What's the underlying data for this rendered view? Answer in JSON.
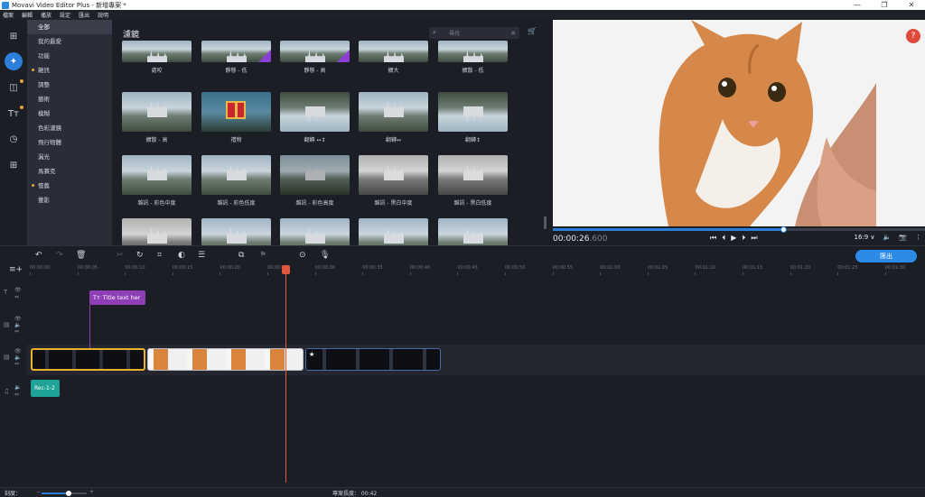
{
  "window": {
    "title": "Movavi Video Editor Plus - 新增專案 *",
    "controls": [
      "—",
      "❐",
      "✕"
    ]
  },
  "menu": [
    "檔案",
    "編輯",
    "播放",
    "設定",
    "匯出",
    "說明"
  ],
  "sidebar_tools": [
    {
      "name": "import-icon",
      "glyph": "⊞"
    },
    {
      "name": "magic-wand-icon",
      "glyph": "✦"
    },
    {
      "name": "transitions-icon",
      "glyph": "◫"
    },
    {
      "name": "titles-icon",
      "glyph": "Tт"
    },
    {
      "name": "stickers-icon",
      "glyph": "◷"
    },
    {
      "name": "more-tools-icon",
      "glyph": "⊞"
    }
  ],
  "categories": [
    {
      "label": "全部",
      "selected": true,
      "dot": false
    },
    {
      "label": "我的最愛",
      "dot": false
    },
    {
      "label": "功能",
      "dot": false
    },
    {
      "label": "雜訊",
      "dot": true
    },
    {
      "label": "調整",
      "dot": false
    },
    {
      "label": "藝術",
      "dot": false
    },
    {
      "label": "模糊",
      "dot": false
    },
    {
      "label": "色彩濾鏡",
      "dot": false
    },
    {
      "label": "飛行物體",
      "dot": false
    },
    {
      "label": "漏光",
      "dot": false
    },
    {
      "label": "馬賽克",
      "dot": false
    },
    {
      "label": "懷舊",
      "dot": true
    },
    {
      "label": "暈影",
      "dot": false
    }
  ],
  "filter_panel": {
    "title": "濾鏡",
    "search_placeholder": "尋找",
    "tiles": [
      {
        "label": "處咬",
        "style": "",
        "premium": false
      },
      {
        "label": "靜態 - 低",
        "style": "",
        "premium": true
      },
      {
        "label": "靜態 - 高",
        "style": "",
        "premium": true
      },
      {
        "label": "擴大",
        "style": "",
        "premium": false
      },
      {
        "label": "擴散 - 低",
        "style": "",
        "premium": false
      },
      {
        "label": "擴散 - 高",
        "style": "",
        "premium": false
      },
      {
        "label": "禮物",
        "style": "gift",
        "premium": false
      },
      {
        "label": "翻轉 ↔↕",
        "style": "flip",
        "premium": false
      },
      {
        "label": "翻轉↔",
        "style": "",
        "premium": false
      },
      {
        "label": "翻轉↕",
        "style": "flip",
        "premium": false
      },
      {
        "label": "雜訊 - 彩色中度",
        "style": "",
        "premium": false
      },
      {
        "label": "雜訊 - 彩色低度",
        "style": "",
        "premium": false
      },
      {
        "label": "雜訊 - 彩色高度",
        "style": "dark",
        "premium": false
      },
      {
        "label": "雜訊 - 黑白中度",
        "style": "gray",
        "premium": false
      },
      {
        "label": "雜訊 - 黑白低度",
        "style": "gray",
        "premium": false
      },
      {
        "label": "",
        "style": "gray",
        "premium": false
      },
      {
        "label": "",
        "style": "",
        "premium": false
      },
      {
        "label": "",
        "style": "",
        "premium": false
      },
      {
        "label": "",
        "style": "",
        "premium": false
      },
      {
        "label": "",
        "style": "",
        "premium": false
      }
    ]
  },
  "preview": {
    "help": "?",
    "progress": 0.62,
    "timecode_main": "00:00:26",
    "timecode_ms": ".600",
    "aspect": "16:9 ∨",
    "transport": [
      "⏮",
      "⏴",
      "▶",
      "⏵",
      "⏭"
    ]
  },
  "toolbar": {
    "export_label": "匯出"
  },
  "ruler": [
    "00:00:00",
    "00:00:05",
    "00:00:10",
    "00:00:15",
    "00:00:20",
    "00:00:25",
    "00:00:30",
    "00:00:35",
    "00:00:40",
    "00:00:45",
    "00:00:50",
    "00:00:55",
    "00:01:00",
    "00:01:05",
    "00:01:10",
    "00:01:15",
    "00:01:20",
    "00:01:25",
    "00:01:30"
  ],
  "timeline": {
    "title_clip": "Title text her",
    "audio_clip": "Rec-1-2"
  },
  "status": {
    "zoom_label": "刻度：",
    "project_length": "專案長度： 00:42"
  },
  "colors": {
    "accent": "#2b7fd8",
    "playhead": "#e0593e",
    "title_clip": "#8e3fb5",
    "audio_clip": "#1fa398",
    "selected_clip": "#e8b12a"
  }
}
